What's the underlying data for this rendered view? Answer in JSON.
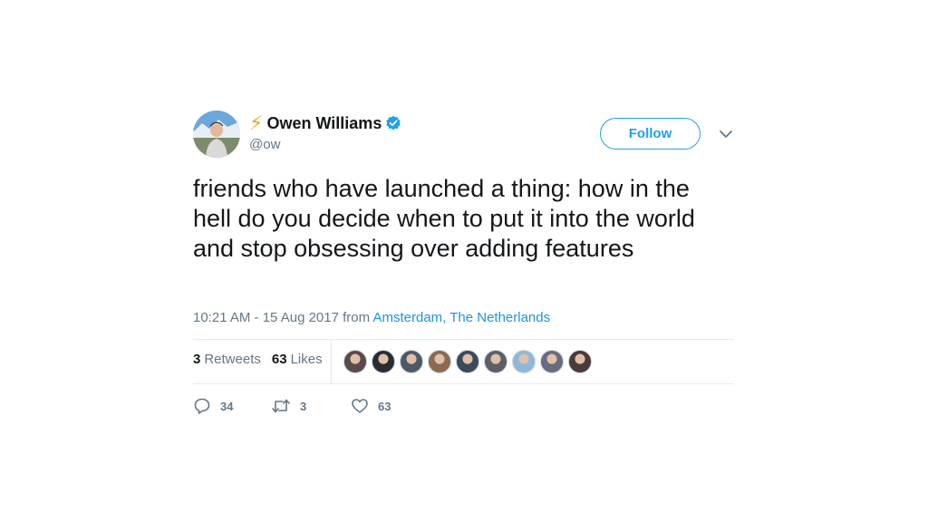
{
  "author": {
    "emoji": "⚡",
    "name": "Owen Williams",
    "handle": "@ow",
    "verified": true
  },
  "follow_button": {
    "label": "Follow"
  },
  "tweet": {
    "text": "friends who have launched a thing: how in the hell do you decide when to put it into the world and stop obsessing over adding features",
    "timestamp": "10:21 AM - 15 Aug 2017 from ",
    "location": "Amsterdam, The Netherlands"
  },
  "stats": {
    "retweets_count": "3",
    "retweets_label": "Retweets",
    "likes_count": "63",
    "likes_label": "Likes"
  },
  "likers_colors": [
    "#5a4a4a",
    "#2b2b33",
    "#4d5a66",
    "#8a6a50",
    "#3a4a5a",
    "#5c5f66",
    "#8fb8d8",
    "#6a6a80",
    "#4a3a3a"
  ],
  "actions": {
    "reply_count": "34",
    "retweet_count": "3",
    "like_count": "63"
  },
  "colors": {
    "accent": "#1da1f2",
    "link": "#1b95e0",
    "muted": "#657786",
    "bolt": "#f5a623"
  }
}
